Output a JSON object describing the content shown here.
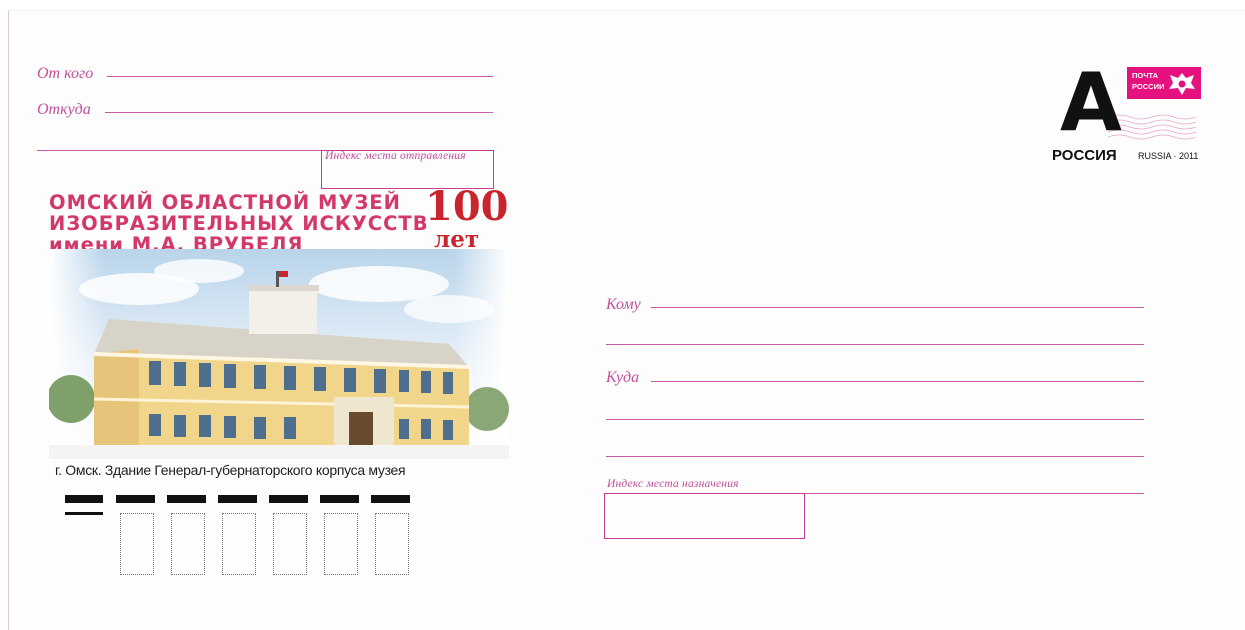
{
  "sender": {
    "from_label": "От кого",
    "address_label": "Откуда",
    "index_label": "Индекс места отправления"
  },
  "artwork": {
    "title_lines": [
      "ОМСКИЙ ОБЛАСТНОЙ МУЗЕЙ",
      "ИЗОБРАЗИТЕЛЬНЫХ ИСКУССТВ",
      "имени М.А. ВРУБЕЛЯ"
    ],
    "anniversary_number": "100",
    "anniversary_word": "лет",
    "caption": "г. Омск. Здание Генерал-губернаторского корпуса музея"
  },
  "recipient": {
    "to_label": "Кому",
    "address_label": "Куда",
    "index_label": "Индекс места назначения"
  },
  "stamp": {
    "letter": "А",
    "logo_line1": "ПОЧТА",
    "logo_line2": "РОССИИ",
    "country": "РОССИЯ",
    "issue": "RUSSIA · 2011"
  },
  "colors": {
    "accent": "#c33d96",
    "title_red": "#d2386a",
    "postal_pink": "#e4117f"
  }
}
